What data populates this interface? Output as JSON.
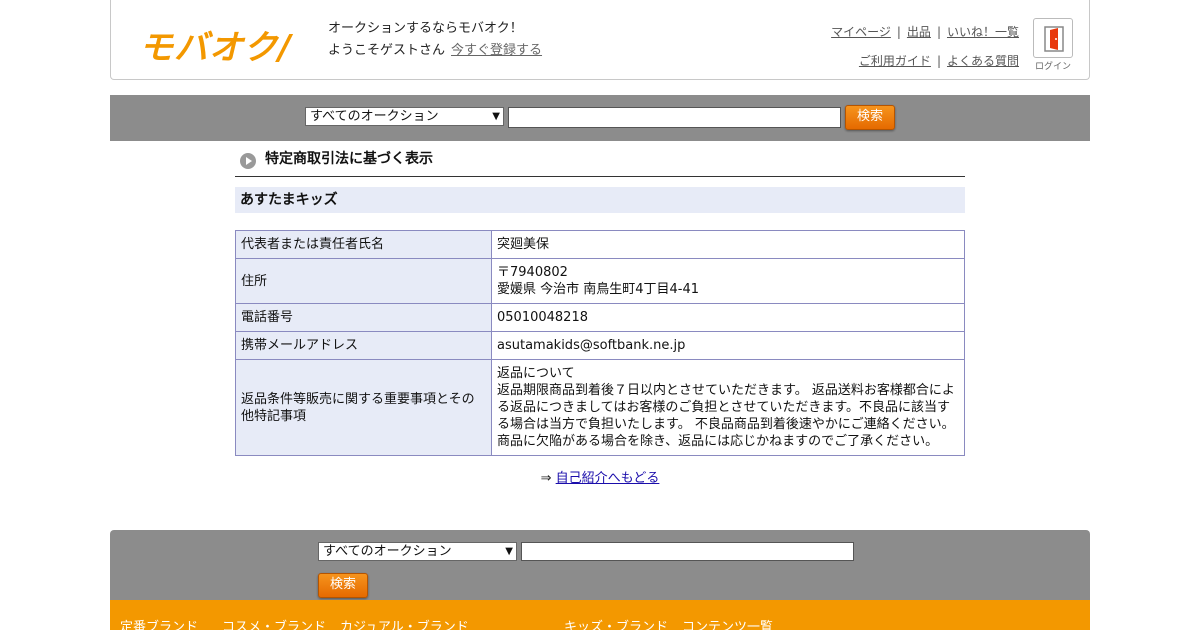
{
  "header": {
    "logo": "モバオク/",
    "greeting": "オークションするならモバオク！",
    "welcome": "ようこそゲストさん",
    "register_link": "今すぐ登録する",
    "links_row1": [
      "マイページ",
      "出品",
      "いいね！一覧"
    ],
    "links_row2": [
      "ご利用ガイド",
      "よくある質問"
    ],
    "login_label": "ログイン"
  },
  "search_top": {
    "category": "すべてのオークション",
    "query": "",
    "button": "検索"
  },
  "section_title": "特定商取引法に基づく表示",
  "shop_name": "あすたまキッズ",
  "info_rows": [
    {
      "key": "代表者または責任者氏名",
      "lines": [
        "突廻美保"
      ]
    },
    {
      "key": "住所",
      "lines": [
        "〒7940802",
        "愛媛県 今治市 南鳥生町4丁目4-41"
      ]
    },
    {
      "key": "電話番号",
      "lines": [
        "05010048218"
      ]
    },
    {
      "key": "携帯メールアドレス",
      "lines": [
        "asutamakids@softbank.ne.jp"
      ]
    },
    {
      "key": "返品条件等販売に関する重要事項とその他特記事項",
      "lines": [
        "返品について",
        "返品期限商品到着後７日以内とさせていただきます。 返品送料お客様都合による返品につきましてはお客様のご負担とさせていただきます。不良品に該当する場合は当方で負担いたします。 不良品商品到着後速やかにご連絡ください。",
        "商品に欠陥がある場合を除き、返品には応じかねますのでご了承ください。"
      ]
    }
  ],
  "back_arrow": "⇒",
  "back_link": "自己紹介へもどる",
  "search_bottom": {
    "category": "すべてのオークション",
    "query": "",
    "button": "検索"
  },
  "footer_links": [
    "定番ブランド",
    "コスメ・ブランド",
    "カジュアル・ブランド",
    "キッズ・ブランド",
    "コンテンツ一覧"
  ],
  "colors": {
    "accent": "#f39800",
    "bar": "#8c8c8c",
    "table_header": "#e7ebf7"
  }
}
